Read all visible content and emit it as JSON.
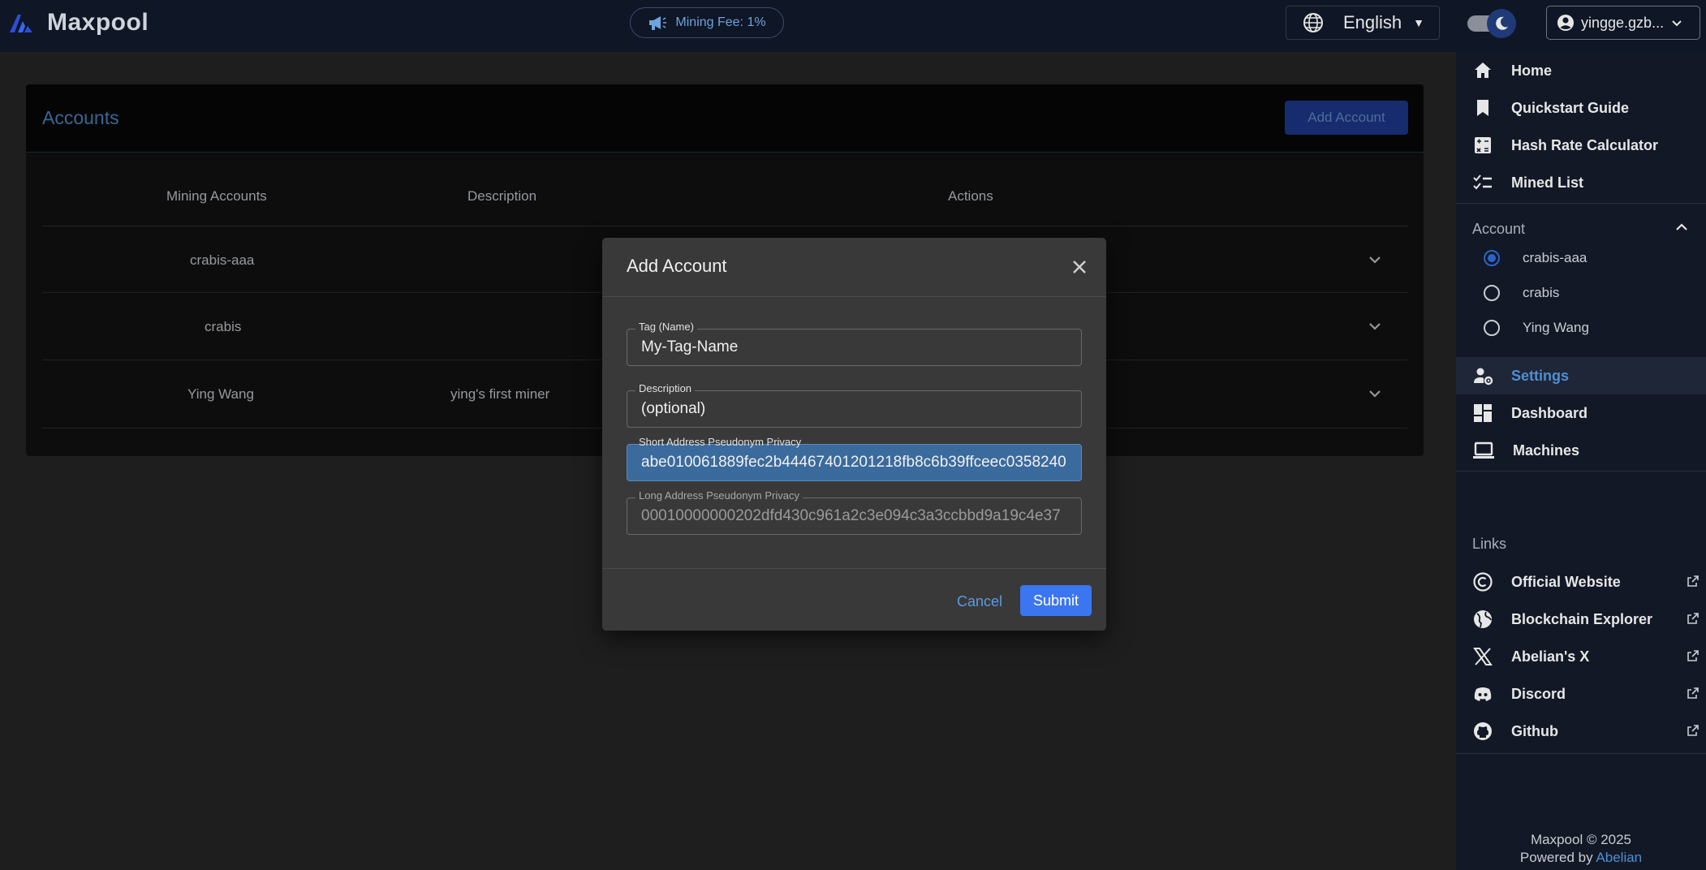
{
  "app": {
    "name": "Maxpool"
  },
  "topbar": {
    "mining_fee": "Mining Fee: 1%",
    "language": "English",
    "user": "yingge.gzb..."
  },
  "sidebar": {
    "nav": [
      {
        "label": "Home",
        "icon": "home-icon"
      },
      {
        "label": "Quickstart Guide",
        "icon": "bookmark-icon"
      },
      {
        "label": "Hash Rate Calculator",
        "icon": "calculator-icon"
      },
      {
        "label": "Mined List",
        "icon": "checklist-icon"
      }
    ],
    "account_section": "Account",
    "accounts": [
      {
        "name": "crabis-aaa",
        "selected": true
      },
      {
        "name": "crabis",
        "selected": false
      },
      {
        "name": "Ying Wang",
        "selected": false
      }
    ],
    "tools": [
      {
        "label": "Settings",
        "icon": "manage-accounts-icon",
        "active": true
      },
      {
        "label": "Dashboard",
        "icon": "dashboard-icon",
        "active": false
      },
      {
        "label": "Machines",
        "icon": "laptop-icon",
        "active": false
      }
    ],
    "links_section": "Links",
    "links": [
      {
        "label": "Official Website",
        "icon": "copyright-icon"
      },
      {
        "label": "Blockchain Explorer",
        "icon": "globe-icon"
      },
      {
        "label": "Abelian's X",
        "icon": "x-logo-icon"
      },
      {
        "label": "Discord",
        "icon": "discord-icon"
      },
      {
        "label": "Github",
        "icon": "github-icon"
      }
    ],
    "footer_copyright": "Maxpool © 2025",
    "footer_powered": "Powered by ",
    "footer_powered_link": "Abelian"
  },
  "main": {
    "card_title": "Accounts",
    "add_account_label": "Add Account",
    "columns": [
      "Mining Accounts",
      "Description",
      "Actions"
    ],
    "rows": [
      {
        "account": "crabis-aaa",
        "description": ""
      },
      {
        "account": "crabis",
        "description": ""
      },
      {
        "account": "Ying Wang",
        "description": "ying's first miner"
      }
    ]
  },
  "dialog": {
    "title": "Add Account",
    "fields": [
      {
        "label": "Tag (Name)",
        "value": "My-Tag-Name"
      },
      {
        "label": "Description",
        "value": "(optional)"
      },
      {
        "label": "Short Address Pseudonym Privacy",
        "value": "abe010061889fec2b44467401201218fb8c6b39ffceec0358240"
      },
      {
        "label": "Long Address Pseudonym Privacy",
        "value": "00010000000202dfd430c961a2c3e094c3a3ccbbd9a19c4e37"
      }
    ],
    "cancel_label": "Cancel",
    "submit_label": "Submit"
  },
  "colors": {
    "accent": "#4d8fd1",
    "primary_button": "#3b76f0",
    "topbar": "#0f1625",
    "sidebar": "#121826"
  }
}
